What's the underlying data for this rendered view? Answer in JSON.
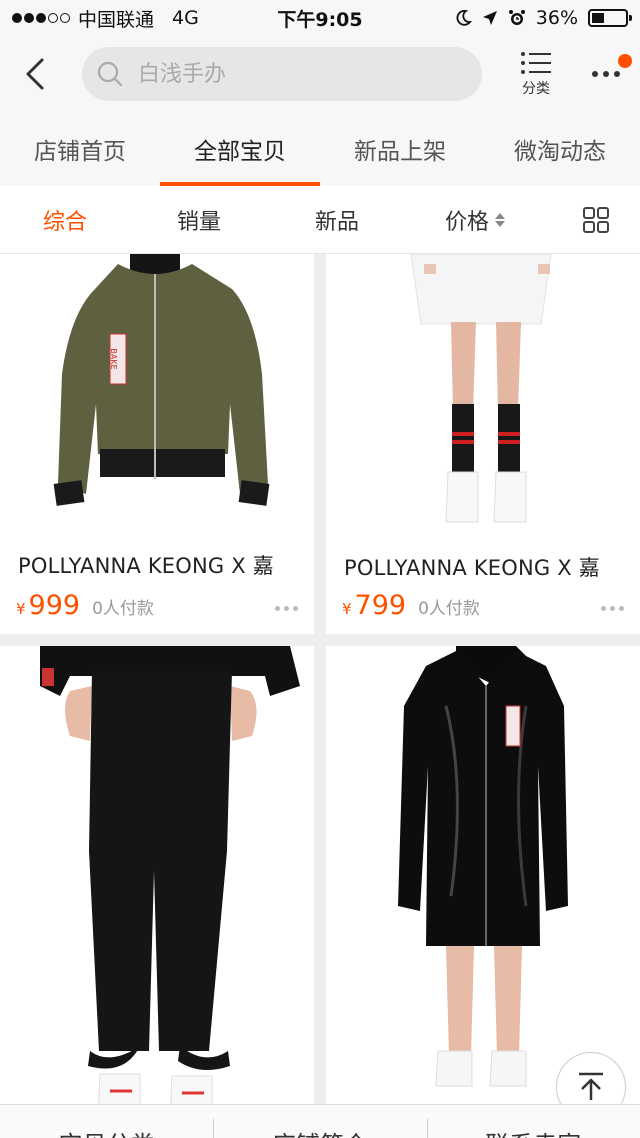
{
  "status_bar": {
    "carrier": "中国联通",
    "network": "4G",
    "time": "下午9:05",
    "battery": "36%",
    "battery_level": 0.36
  },
  "header": {
    "search_placeholder": "白浅手办",
    "category_label": "分类"
  },
  "shop_tabs": [
    {
      "label": "店铺首页"
    },
    {
      "label": "全部宝贝",
      "active": true
    },
    {
      "label": "新品上架"
    },
    {
      "label": "微淘动态"
    }
  ],
  "sort_bar": {
    "items": [
      {
        "label": "综合",
        "active": true
      },
      {
        "label": "销量"
      },
      {
        "label": "新品"
      },
      {
        "label": "价格"
      }
    ]
  },
  "products": [
    {
      "title": "POLLYANNA KEONG X 嘉",
      "currency": "¥",
      "price": "999",
      "sold": "0人付款",
      "image": "olive-bomber-jacket"
    },
    {
      "title": "POLLYANNA KEONG X 嘉",
      "currency": "¥",
      "price": "799",
      "sold": "0人付款",
      "image": "white-skirt-striped-socks"
    },
    {
      "title": "",
      "currency": "",
      "price": "",
      "sold": "",
      "image": "black-flared-jeans"
    },
    {
      "title": "",
      "currency": "",
      "price": "",
      "sold": "",
      "image": "black-vinyl-coat"
    }
  ],
  "bottom_bar": {
    "items": [
      {
        "label": "宝贝分类"
      },
      {
        "label": "店铺简介"
      },
      {
        "label": "联系卖家"
      }
    ]
  },
  "colors": {
    "accent": "#ff5000",
    "text": "#222222",
    "muted": "#999999",
    "background": "#eeeeee"
  }
}
